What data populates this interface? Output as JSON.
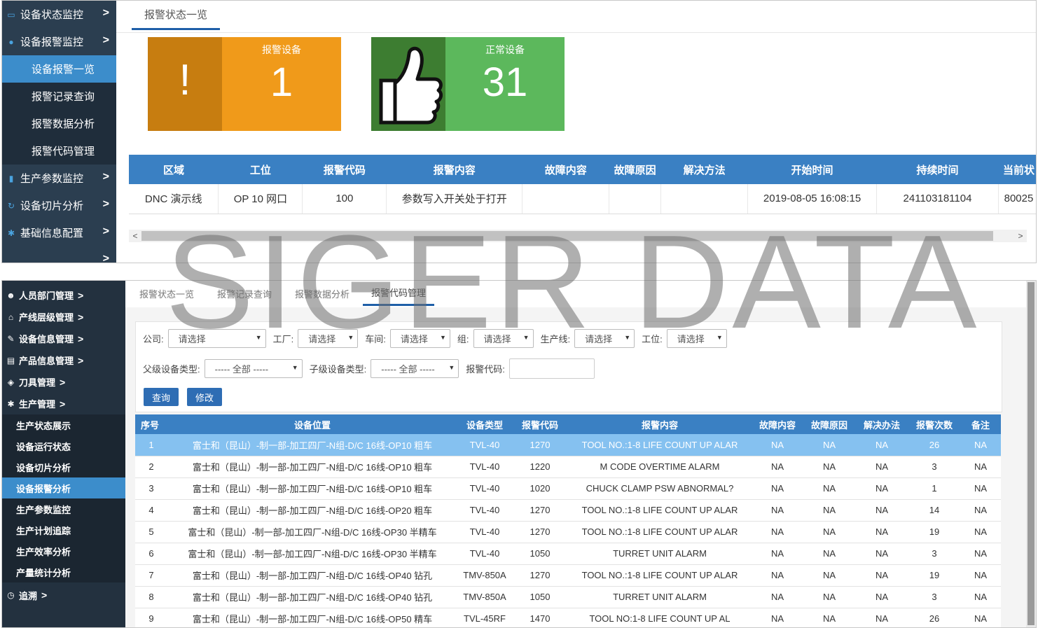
{
  "top": {
    "sidebar": {
      "items": [
        {
          "label": "设备状态监控",
          "icon": "monitor-icon"
        },
        {
          "label": "设备报警监控",
          "icon": "bell-icon"
        }
      ],
      "subitems": [
        {
          "label": "设备报警一览",
          "active": true
        },
        {
          "label": "报警记录查询",
          "active": false
        },
        {
          "label": "报警数据分析",
          "active": false
        },
        {
          "label": "报警代码管理",
          "active": false
        }
      ],
      "items2": [
        {
          "label": "生产参数监控",
          "icon": "bar-chart-icon"
        },
        {
          "label": "设备切片分析",
          "icon": "refresh-icon"
        },
        {
          "label": "基础信息配置",
          "icon": "gear-icon"
        }
      ]
    },
    "tab": "报警状态一览",
    "cards": {
      "alarm": {
        "label": "报警设备",
        "value": "1",
        "icon": "!",
        "left_color": "#c77d10",
        "right_color": "#f09a1a"
      },
      "normal": {
        "label": "正常设备",
        "value": "31",
        "icon": "thumbs-up-icon",
        "left_color": "#3d7d31",
        "right_color": "#5cb85c"
      }
    },
    "table": {
      "headers": [
        "区域",
        "工位",
        "报警代码",
        "报警内容",
        "故障内容",
        "故障原因",
        "解决方法",
        "开始时间",
        "持续时间",
        "当前状"
      ],
      "rows": [
        [
          "DNC 演示线",
          "OP 10 网口",
          "100",
          "参数写入开关处于打开",
          "",
          "",
          "",
          "2019-08-05 16:08:15",
          "241103181104",
          "80025"
        ]
      ]
    }
  },
  "bottom": {
    "sidebar": {
      "items": [
        {
          "label": "人员部门管理",
          "icon": "user-icon"
        },
        {
          "label": "产线层级管理",
          "icon": "building-icon"
        },
        {
          "label": "设备信息管理",
          "icon": "edit-icon"
        },
        {
          "label": "产品信息管理",
          "icon": "book-icon"
        },
        {
          "label": "刀具管理",
          "icon": "tool-icon"
        },
        {
          "label": "生产管理",
          "icon": "gear-icon"
        }
      ],
      "subitems": [
        {
          "label": "生产状态展示",
          "active": false
        },
        {
          "label": "设备运行状态",
          "active": false
        },
        {
          "label": "设备切片分析",
          "active": false
        },
        {
          "label": "设备报警分析",
          "active": true
        },
        {
          "label": "生产参数监控",
          "active": false
        },
        {
          "label": "生产计划追踪",
          "active": false
        },
        {
          "label": "生产效率分析",
          "active": false
        },
        {
          "label": "产量统计分析",
          "active": false
        }
      ],
      "trace": {
        "label": "追溯",
        "icon": "clock-icon"
      }
    },
    "tabs": [
      "报警状态一览",
      "报警记录查询",
      "报警数据分析",
      "报警代码管理"
    ],
    "filters": {
      "company": {
        "label": "公司:",
        "value": "请选择"
      },
      "factory": {
        "label": "工厂:",
        "value": "请选择"
      },
      "workshop": {
        "label": "车间:",
        "value": "请选择"
      },
      "group": {
        "label": "组:",
        "value": "请选择"
      },
      "line": {
        "label": "生产线:",
        "value": "请选择"
      },
      "station": {
        "label": "工位:",
        "value": "请选择"
      },
      "parent_type": {
        "label": "父级设备类型:",
        "value": "----- 全部 -----"
      },
      "child_type": {
        "label": "子级设备类型:",
        "value": "----- 全部 -----"
      },
      "alarm_code": {
        "label": "报警代码:",
        "value": ""
      }
    },
    "buttons": {
      "query": "查询",
      "edit": "修改"
    },
    "table": {
      "headers": [
        "序号",
        "设备位置",
        "设备类型",
        "报警代码",
        "报警内容",
        "故障内容",
        "故障原因",
        "解决办法",
        "报警次数",
        "备注"
      ],
      "rows": [
        [
          "1",
          "富士和（昆山）-制一部-加工四厂-N组-D/C 16线-OP10 粗车",
          "TVL-40",
          "1270",
          "TOOL NO.:1-8 LIFE COUNT UP ALAR",
          "NA",
          "NA",
          "NA",
          "26",
          "NA"
        ],
        [
          "2",
          "富士和（昆山）-制一部-加工四厂-N组-D/C 16线-OP10 粗车",
          "TVL-40",
          "1220",
          "M CODE OVERTIME ALARM",
          "NA",
          "NA",
          "NA",
          "3",
          "NA"
        ],
        [
          "3",
          "富士和（昆山）-制一部-加工四厂-N组-D/C 16线-OP10 粗车",
          "TVL-40",
          "1020",
          "CHUCK CLAMP PSW ABNORMAL?",
          "NA",
          "NA",
          "NA",
          "1",
          "NA"
        ],
        [
          "4",
          "富士和（昆山）-制一部-加工四厂-N组-D/C 16线-OP20 粗车",
          "TVL-40",
          "1270",
          "TOOL NO.:1-8 LIFE COUNT UP ALAR",
          "NA",
          "NA",
          "NA",
          "14",
          "NA"
        ],
        [
          "5",
          "富士和（昆山）-制一部-加工四厂-N组-D/C 16线-OP30 半精车",
          "TVL-40",
          "1270",
          "TOOL NO.:1-8 LIFE COUNT UP ALAR",
          "NA",
          "NA",
          "NA",
          "19",
          "NA"
        ],
        [
          "6",
          "富士和（昆山）-制一部-加工四厂-N组-D/C 16线-OP30 半精车",
          "TVL-40",
          "1050",
          "TURRET UNIT ALARM",
          "NA",
          "NA",
          "NA",
          "3",
          "NA"
        ],
        [
          "7",
          "富士和（昆山）-制一部-加工四厂-N组-D/C 16线-OP40 钻孔",
          "TMV-850A",
          "1270",
          "TOOL NO.:1-8 LIFE COUNT UP ALAR",
          "NA",
          "NA",
          "NA",
          "19",
          "NA"
        ],
        [
          "8",
          "富士和（昆山）-制一部-加工四厂-N组-D/C 16线-OP40 钻孔",
          "TMV-850A",
          "1050",
          "TURRET UNIT ALARM",
          "NA",
          "NA",
          "NA",
          "3",
          "NA"
        ],
        [
          "9",
          "富士和（昆山）-制一部-加工四厂-N组-D/C 16线-OP50 精车",
          "TVL-45RF",
          "1470",
          "TOOL NO:1-8 LIFE COUNT UP AL",
          "NA",
          "NA",
          "NA",
          "26",
          "NA"
        ]
      ]
    }
  },
  "watermark": "SIGER DATA"
}
